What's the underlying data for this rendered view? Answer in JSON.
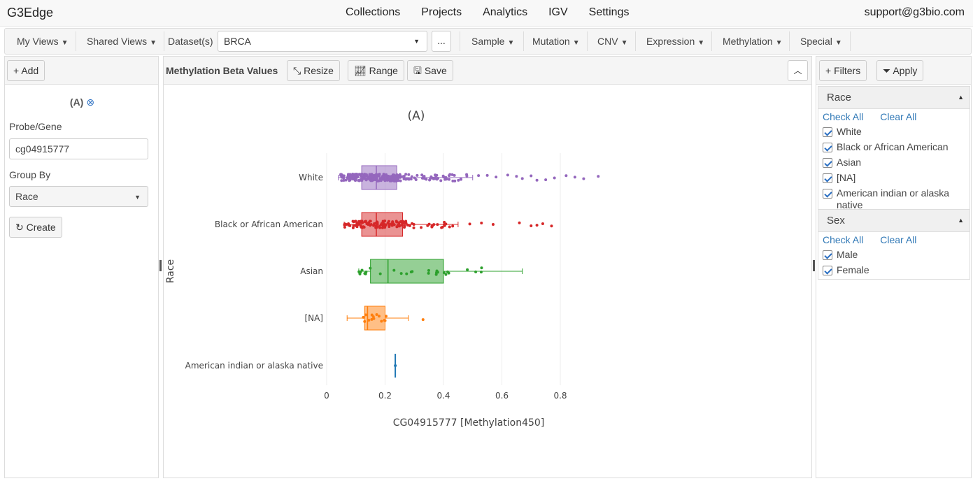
{
  "app": {
    "brand": "G3Edge",
    "support": "support@g3bio.com"
  },
  "nav": [
    "Collections",
    "Projects",
    "Analytics",
    "IGV",
    "Settings"
  ],
  "toolbar": {
    "my_views": "My Views",
    "shared_views": "Shared Views",
    "dataset_label": "Dataset(s)",
    "dataset_value": "BRCA",
    "more": "...",
    "menus": [
      "Sample",
      "Mutation",
      "CNV",
      "Expression",
      "Methylation",
      "Special"
    ]
  },
  "left": {
    "add": "Add",
    "plot_label": "(A)",
    "probe_label": "Probe/Gene",
    "probe_value": "cg04915777",
    "group_label": "Group By",
    "group_value": "Race",
    "create": "Create"
  },
  "center": {
    "title": "Methylation Beta Values",
    "resize": "Resize",
    "range": "Range",
    "save": "Save"
  },
  "right": {
    "filters": "Filters",
    "apply": "Apply",
    "check_all": "Check All",
    "clear_all": "Clear All",
    "groups": [
      {
        "title": "Race",
        "items": [
          "White",
          "Black or African American",
          "Asian",
          "[NA]",
          "American indian or alaska native"
        ]
      },
      {
        "title": "Sex",
        "items": [
          "Male",
          "Female"
        ]
      }
    ]
  },
  "chart_data": {
    "type": "box",
    "orientation": "horizontal",
    "title": "(A)",
    "xlabel": "CG04915777 [Methylation450]",
    "ylabel": "Race",
    "xlim": [
      0,
      0.95
    ],
    "xticks": [
      0,
      0.2,
      0.4,
      0.6,
      0.8
    ],
    "grid": true,
    "categories": [
      "White",
      "Black or African American",
      "Asian",
      "[NA]",
      "American indian or alaska native"
    ],
    "series": [
      {
        "name": "White",
        "color": "#9467bd",
        "min": 0.04,
        "q1": 0.12,
        "median": 0.17,
        "q3": 0.24,
        "max": 0.5,
        "outliers": [
          0.52,
          0.55,
          0.58,
          0.62,
          0.65,
          0.67,
          0.7,
          0.72,
          0.75,
          0.78,
          0.82,
          0.85,
          0.88,
          0.93
        ]
      },
      {
        "name": "Black or African American",
        "color": "#d62728",
        "min": 0.06,
        "q1": 0.12,
        "median": 0.17,
        "q3": 0.26,
        "max": 0.45,
        "outliers": [
          0.49,
          0.53,
          0.57,
          0.66,
          0.7,
          0.72,
          0.74,
          0.77
        ]
      },
      {
        "name": "Asian",
        "color": "#2ca02c",
        "min": 0.11,
        "q1": 0.15,
        "median": 0.21,
        "q3": 0.4,
        "max": 0.67,
        "outliers": []
      },
      {
        "name": "[NA]",
        "color": "#ff7f0e",
        "min": 0.07,
        "q1": 0.13,
        "median": 0.14,
        "q3": 0.2,
        "max": 0.28,
        "outliers": [
          0.33
        ]
      },
      {
        "name": "American indian or alaska native",
        "color": "#1f77b4",
        "min": 0.235,
        "q1": 0.235,
        "median": 0.235,
        "q3": 0.235,
        "max": 0.235,
        "outliers": []
      }
    ]
  }
}
